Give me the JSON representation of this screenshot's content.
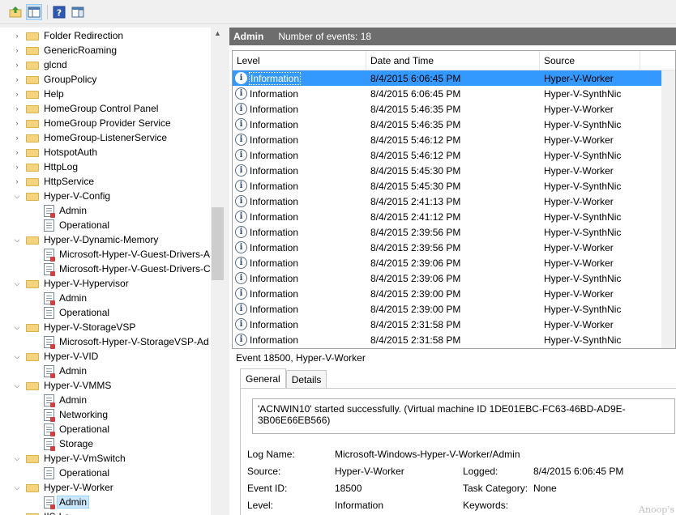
{
  "tree": {
    "items": [
      {
        "label": "Folder Redirection",
        "kind": "folder"
      },
      {
        "label": "GenericRoaming",
        "kind": "folder"
      },
      {
        "label": "glcnd",
        "kind": "folder"
      },
      {
        "label": "GroupPolicy",
        "kind": "folder"
      },
      {
        "label": "Help",
        "kind": "folder"
      },
      {
        "label": "HomeGroup Control Panel",
        "kind": "folder"
      },
      {
        "label": "HomeGroup Provider Service",
        "kind": "folder"
      },
      {
        "label": "HomeGroup-ListenerService",
        "kind": "folder"
      },
      {
        "label": "HotspotAuth",
        "kind": "folder"
      },
      {
        "label": "HttpLog",
        "kind": "folder"
      },
      {
        "label": "HttpService",
        "kind": "folder"
      },
      {
        "label": "Hyper-V-Config",
        "kind": "folder-open"
      },
      {
        "label": "Admin",
        "kind": "log-admin"
      },
      {
        "label": "Operational",
        "kind": "log"
      },
      {
        "label": "Hyper-V-Dynamic-Memory",
        "kind": "folder-open"
      },
      {
        "label": "Microsoft-Hyper-V-Guest-Drivers-A",
        "kind": "log-admin"
      },
      {
        "label": "Microsoft-Hyper-V-Guest-Drivers-C",
        "kind": "log-admin"
      },
      {
        "label": "Hyper-V-Hypervisor",
        "kind": "folder-open"
      },
      {
        "label": "Admin",
        "kind": "log-admin"
      },
      {
        "label": "Operational",
        "kind": "log"
      },
      {
        "label": "Hyper-V-StorageVSP",
        "kind": "folder-open"
      },
      {
        "label": "Microsoft-Hyper-V-StorageVSP-Ad",
        "kind": "log-admin"
      },
      {
        "label": "Hyper-V-VID",
        "kind": "folder-open"
      },
      {
        "label": "Admin",
        "kind": "log-admin"
      },
      {
        "label": "Hyper-V-VMMS",
        "kind": "folder-open"
      },
      {
        "label": "Admin",
        "kind": "log-admin"
      },
      {
        "label": "Networking",
        "kind": "log-admin"
      },
      {
        "label": "Operational",
        "kind": "log-admin"
      },
      {
        "label": "Storage",
        "kind": "log-admin"
      },
      {
        "label": "Hyper-V-VmSwitch",
        "kind": "folder-open"
      },
      {
        "label": "Operational",
        "kind": "log"
      },
      {
        "label": "Hyper-V-Worker",
        "kind": "folder-open"
      },
      {
        "label": "Admin",
        "kind": "log-admin",
        "selected": true
      },
      {
        "label": "IIS-Lo",
        "kind": "folder"
      }
    ]
  },
  "header": {
    "title": "Admin",
    "count_text": "Number of events: 18"
  },
  "grid": {
    "columns": [
      "Level",
      "Date and Time",
      "Source"
    ],
    "rows": [
      {
        "level": "Information",
        "date": "8/4/2015 6:06:45 PM",
        "source": "Hyper-V-Worker",
        "selected": true
      },
      {
        "level": "Information",
        "date": "8/4/2015 6:06:45 PM",
        "source": "Hyper-V-SynthNic"
      },
      {
        "level": "Information",
        "date": "8/4/2015 5:46:35 PM",
        "source": "Hyper-V-Worker"
      },
      {
        "level": "Information",
        "date": "8/4/2015 5:46:35 PM",
        "source": "Hyper-V-SynthNic"
      },
      {
        "level": "Information",
        "date": "8/4/2015 5:46:12 PM",
        "source": "Hyper-V-Worker"
      },
      {
        "level": "Information",
        "date": "8/4/2015 5:46:12 PM",
        "source": "Hyper-V-SynthNic"
      },
      {
        "level": "Information",
        "date": "8/4/2015 5:45:30 PM",
        "source": "Hyper-V-Worker"
      },
      {
        "level": "Information",
        "date": "8/4/2015 5:45:30 PM",
        "source": "Hyper-V-SynthNic"
      },
      {
        "level": "Information",
        "date": "8/4/2015 2:41:13 PM",
        "source": "Hyper-V-Worker"
      },
      {
        "level": "Information",
        "date": "8/4/2015 2:41:12 PM",
        "source": "Hyper-V-SynthNic"
      },
      {
        "level": "Information",
        "date": "8/4/2015 2:39:56 PM",
        "source": "Hyper-V-SynthNic"
      },
      {
        "level": "Information",
        "date": "8/4/2015 2:39:56 PM",
        "source": "Hyper-V-Worker"
      },
      {
        "level": "Information",
        "date": "8/4/2015 2:39:06 PM",
        "source": "Hyper-V-Worker"
      },
      {
        "level": "Information",
        "date": "8/4/2015 2:39:06 PM",
        "source": "Hyper-V-SynthNic"
      },
      {
        "level": "Information",
        "date": "8/4/2015 2:39:00 PM",
        "source": "Hyper-V-Worker"
      },
      {
        "level": "Information",
        "date": "8/4/2015 2:39:00 PM",
        "source": "Hyper-V-SynthNic"
      },
      {
        "level": "Information",
        "date": "8/4/2015 2:31:58 PM",
        "source": "Hyper-V-Worker"
      },
      {
        "level": "Information",
        "date": "8/4/2015 2:31:58 PM",
        "source": "Hyper-V-SynthNic"
      }
    ]
  },
  "detail": {
    "title": "Event 18500, Hyper-V-Worker",
    "tabs": [
      "General",
      "Details"
    ],
    "message": "'ACNWIN10' started successfully. (Virtual machine ID 1DE01EBC-FC63-46BD-AD9E-3B06E66EB566)",
    "props": {
      "log_name_label": "Log Name:",
      "log_name_value": "Microsoft-Windows-Hyper-V-Worker/Admin",
      "source_label": "Source:",
      "source_value": "Hyper-V-Worker",
      "logged_label": "Logged:",
      "logged_value": "8/4/2015 6:06:45 PM",
      "event_id_label": "Event ID:",
      "event_id_value": "18500",
      "task_label": "Task Category:",
      "task_value": "None",
      "level_label": "Level:",
      "level_value": "Information",
      "keywords_label": "Keywords:"
    }
  },
  "watermark": "Anoop's"
}
